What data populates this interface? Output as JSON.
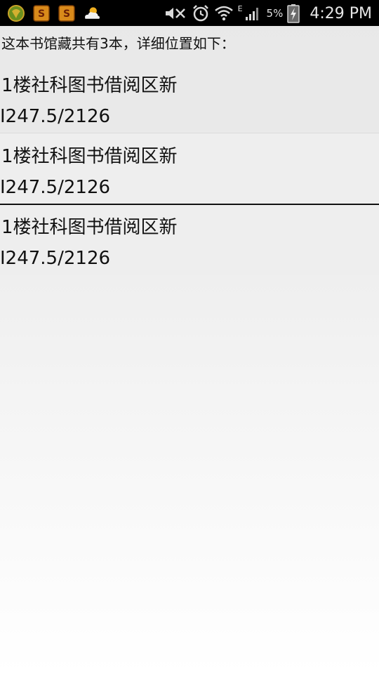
{
  "status_bar": {
    "left_icons": [
      "app-globe-icon",
      "app-s-icon",
      "app-s-icon",
      "weather-cloud-icon"
    ],
    "right_icons": [
      "mute-icon",
      "alarm-icon",
      "wifi-icon",
      "signal-icon",
      "battery-charging-icon"
    ],
    "network_type": "E",
    "battery_percent": "5%",
    "time": "4:29 PM"
  },
  "summary_text": "这本书馆藏共有3本，详细位置如下：",
  "locations": [
    {
      "name": "1楼社科图书借阅区新",
      "call_number": "I247.5/2126"
    },
    {
      "name": "1楼社科图书借阅区新",
      "call_number": "I247.5/2126"
    },
    {
      "name": "1楼社科图书借阅区新",
      "call_number": "I247.5/2126"
    }
  ]
}
